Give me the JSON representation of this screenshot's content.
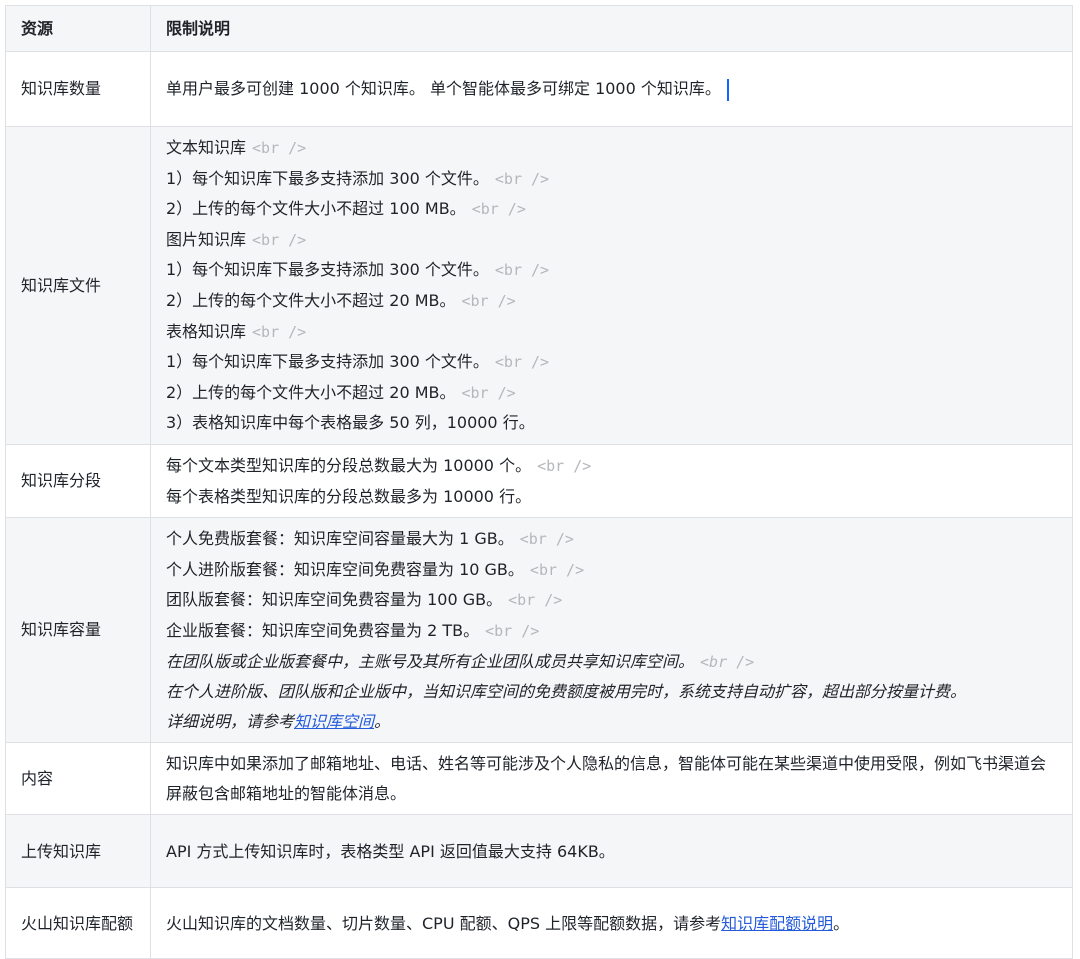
{
  "header": {
    "col1": "资源",
    "col2": "限制说明"
  },
  "br_tag": "<br />",
  "rows": [
    {
      "name": "知识库数量",
      "lines": [
        "单用户最多可创建 1000 个知识库。 单个智能体最多可绑定 1000 个知识库。"
      ]
    },
    {
      "name": "知识库文件",
      "lines": [
        "文本知识库",
        "1）每个知识库下最多支持添加 300 个文件。",
        "2）上传的每个文件大小不超过 100 MB。",
        "图片知识库",
        "1）每个知识库下最多支持添加 300 个文件。",
        "2）上传的每个文件大小不超过 20 MB。",
        "表格知识库",
        "1）每个知识库下最多支持添加 300 个文件。",
        "2）上传的每个文件大小不超过 20 MB。",
        "3）表格知识库中每个表格最多 50 列，10000 行。"
      ]
    },
    {
      "name": "知识库分段",
      "lines": [
        "每个文本类型知识库的分段总数最大为 10000 个。",
        "每个表格类型知识库的分段总数最多为 10000 行。"
      ]
    },
    {
      "name": "知识库容量",
      "lines": [
        "个人免费版套餐：知识库空间容量最大为 1 GB。",
        "个人进阶版套餐：知识库空间免费容量为 10 GB。",
        "团队版套餐：知识库空间免费容量为 100 GB。",
        "企业版套餐：知识库空间免费容量为 2 TB。",
        "在团队版或企业版套餐中，主账号及其所有企业团队成员共享知识库空间。",
        "在个人进阶版、团队版和企业版中，当知识库空间的免费额度被用完时，系统支持自动扩容，超出部分按量计费。"
      ],
      "note_prefix": "详细说明，请参考",
      "note_link": "知识库空间",
      "note_suffix": "。"
    },
    {
      "name": "内容",
      "lines": [
        "知识库中如果添加了邮箱地址、电话、姓名等可能涉及个人隐私的信息，智能体可能在某些渠道中使用受限，例如飞书渠道会屏蔽包含邮箱地址的智能体消息。"
      ]
    },
    {
      "name": "上传知识库",
      "lines": [
        "API 方式上传知识库时，表格类型 API 返回值最大支持 64KB。"
      ]
    },
    {
      "name": "火山知识库配额",
      "prefix": "火山知识库的文档数量、切片数量、CPU 配额、QPS 上限等配额数据，请参考",
      "link": "知识库配额说明",
      "suffix": "。"
    }
  ]
}
